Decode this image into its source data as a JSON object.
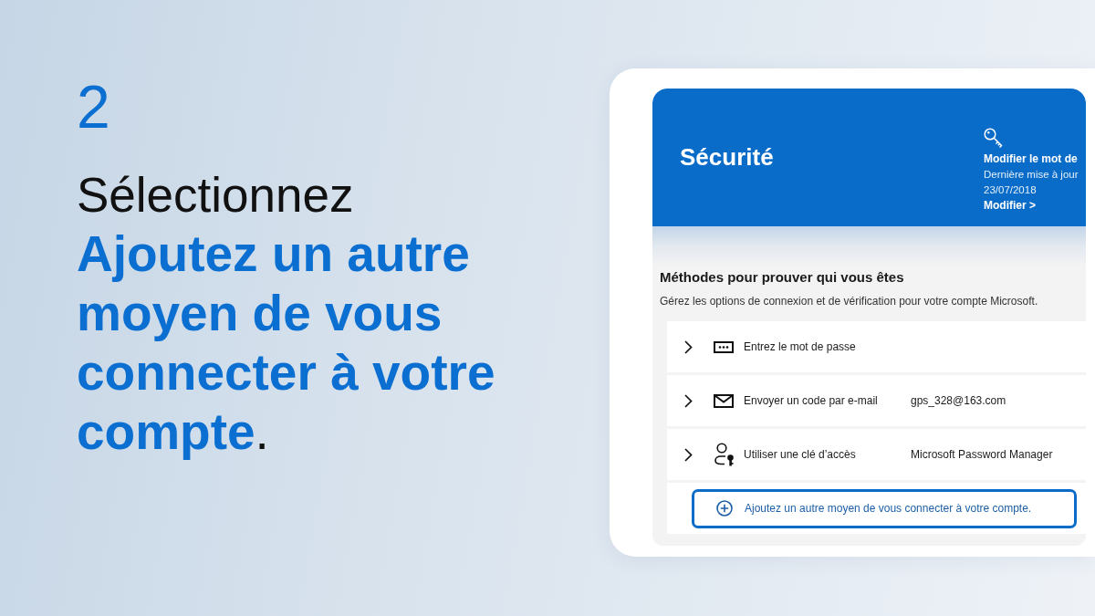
{
  "step": {
    "number": "2",
    "action": "Sélectionnez",
    "target": "**Ajoutez un autre moyen de vous connecter à votre compte**."
  },
  "security_page": {
    "header": {
      "title": "Sécurité",
      "password_card": {
        "title": "Modifier le mot de",
        "updated_label": "Dernière mise à jour",
        "updated_date": "23/07/2018",
        "link": "Modifier >"
      }
    },
    "section": {
      "title": "Méthodes pour prouver qui vous êtes",
      "description": "Gérez les options de connexion et de vérification pour votre compte Microsoft."
    },
    "methods": [
      {
        "kind": "password",
        "label": "Entrez le mot de passe",
        "expanded": false
      },
      {
        "kind": "email",
        "label": "Envoyer un code par e-mail",
        "value": "gps_328@163.com",
        "expanded": false
      },
      {
        "kind": "passkey",
        "label": "Utiliser une clé d’accès",
        "value": "Microsoft Password Manager",
        "expanded": false
      }
    ],
    "add_method": {
      "label": "Ajoutez un autre moyen de vous connecter à votre compte.",
      "highlighted": true
    }
  }
}
